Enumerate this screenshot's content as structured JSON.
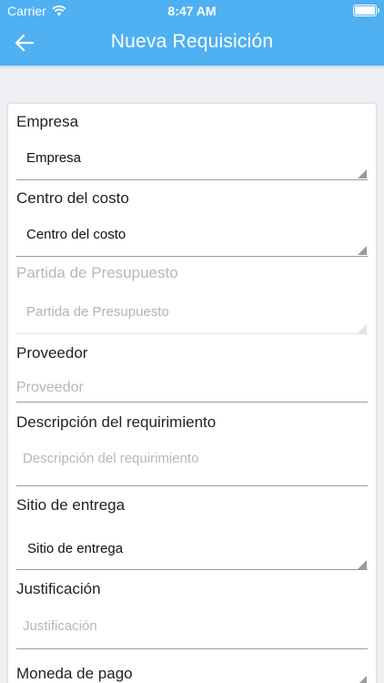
{
  "status_bar": {
    "carrier": "Carrier",
    "time": "8:47 AM",
    "icons": [
      "wifi-icon",
      "battery-icon"
    ]
  },
  "header": {
    "title": "Nueva Requisición",
    "back_icon": "arrow-left-icon"
  },
  "colors": {
    "accent": "#4fb0f2",
    "background": "#eef0f4"
  },
  "form": {
    "empresa": {
      "label": "Empresa",
      "value": "Empresa"
    },
    "centro_costo": {
      "label": "Centro del costo",
      "value": "Centro del costo"
    },
    "partida": {
      "label": "Partida de Presupuesto",
      "value": "Partida de Presupuesto"
    },
    "proveedor": {
      "label": "Proveedor",
      "placeholder": "Proveedor"
    },
    "descripcion": {
      "label": "Descripción del requirimiento",
      "placeholder": "Descripción del requirimiento"
    },
    "sitio": {
      "label": "Sitio de entrega",
      "value": "Sitio de entrega"
    },
    "justificacion": {
      "label": "Justificación",
      "placeholder": "Justificación"
    },
    "moneda": {
      "label": "Moneda de pago"
    }
  }
}
